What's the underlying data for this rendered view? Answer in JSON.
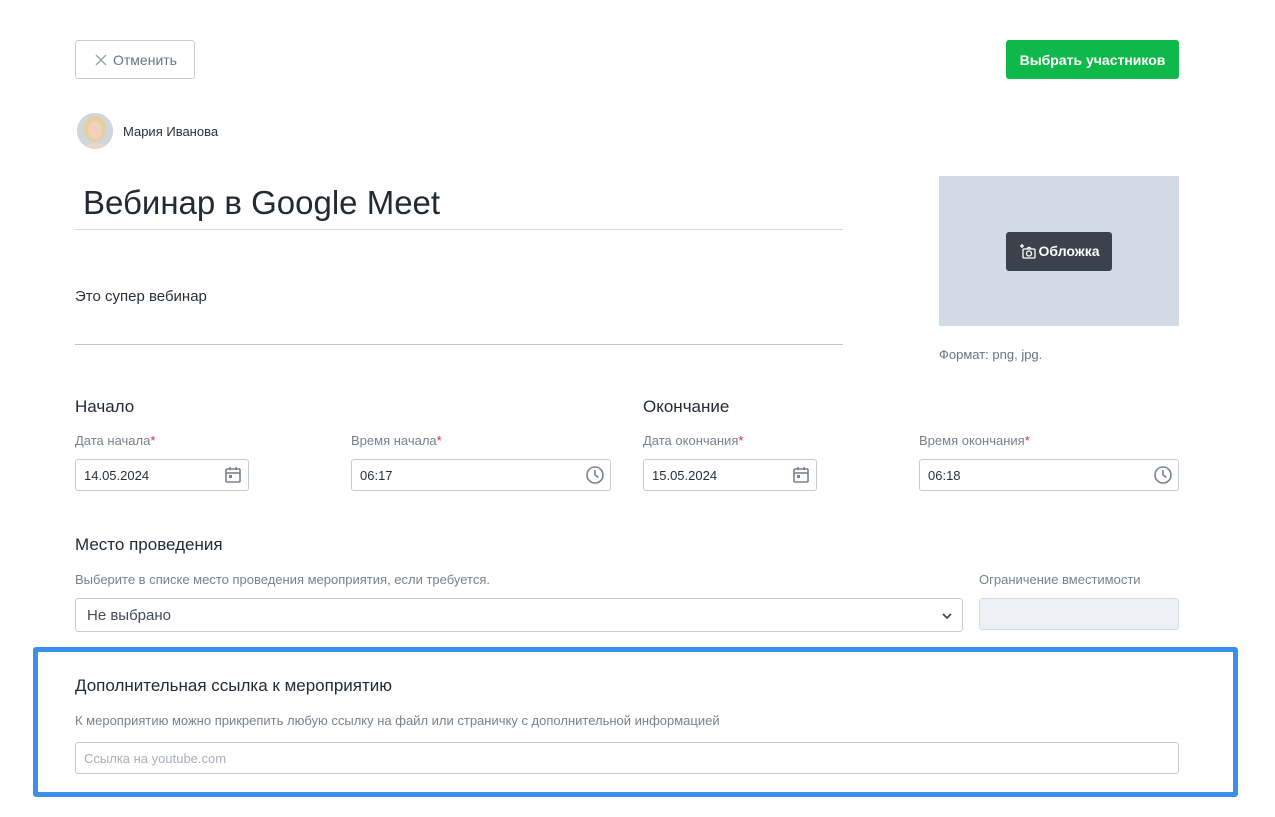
{
  "toolbar": {
    "cancel_label": "Отменить",
    "select_participants_label": "Выбрать участников",
    "primary_color": "#0fb84a"
  },
  "author": {
    "name": "Мария Иванова"
  },
  "event": {
    "title": "Вебинар в Google Meet",
    "description": "Это супер вебинар"
  },
  "cover": {
    "button_label": "Обложка",
    "format_hint": "Формат: png, jpg."
  },
  "start": {
    "heading": "Начало",
    "date_label": "Дата начала",
    "date_value": "14.05.2024",
    "time_label": "Время начала",
    "time_value": "06:17"
  },
  "end": {
    "heading": "Окончание",
    "date_label": "Дата окончания",
    "date_value": "15.05.2024",
    "time_label": "Время окончания",
    "time_value": "06:18"
  },
  "required_mark": "*",
  "venue": {
    "heading": "Место проведения",
    "hint": "Выберите в списке место проведения мероприятия, если требуется.",
    "selected": "Не выбрано",
    "capacity_label": "Ограничение вместимости"
  },
  "extra_link": {
    "heading": "Дополнительная ссылка к мероприятию",
    "hint": "К мероприятию можно прикрепить любую ссылку на файл или страничку с дополнительной информацией",
    "placeholder": "Ссылка на youtube.com",
    "highlight_color": "#3b8eea"
  }
}
